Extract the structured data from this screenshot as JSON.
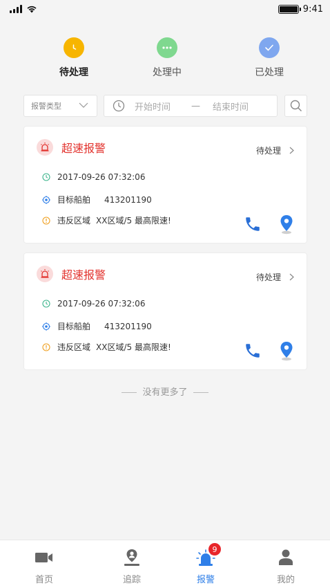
{
  "status_bar": {
    "time": "9:41"
  },
  "steps": [
    {
      "label": "待处理",
      "state": "active",
      "color": "#f7b500"
    },
    {
      "label": "处理中",
      "state": "inactive",
      "color": "#7fd88f"
    },
    {
      "label": "已处理",
      "state": "inactive",
      "color": "#7fa7ef"
    }
  ],
  "filter": {
    "type_select": "报警类型",
    "start_placeholder": "开始时间",
    "separator": "—",
    "end_placeholder": "结束时间"
  },
  "alarms": [
    {
      "title": "超速报警",
      "status": "待处理",
      "datetime": "2017-09-26  07:32:06",
      "target_label": "目标船舶",
      "target_value": "413201190",
      "violation_label": "违反区域",
      "violation_value": "XX区域/5  最高限速!"
    },
    {
      "title": "超速报警",
      "status": "待处理",
      "datetime": "2017-09-26  07:32:06",
      "target_label": "目标船舶",
      "target_value": "413201190",
      "violation_label": "违反区域",
      "violation_value": "XX区域/5  最高限速!"
    }
  ],
  "no_more_text": "没有更多了",
  "tabbar": {
    "tabs": [
      {
        "label": "首页",
        "icon": "video-camera-icon"
      },
      {
        "label": "追踪",
        "icon": "location-person-icon"
      },
      {
        "label": "报警",
        "icon": "alarm-siren-icon",
        "badge": "9",
        "active": true
      },
      {
        "label": "我的",
        "icon": "user-icon"
      }
    ]
  },
  "colors": {
    "accent": "#2f7fe8",
    "alert": "#e2322d",
    "badge": "#e8262b"
  }
}
